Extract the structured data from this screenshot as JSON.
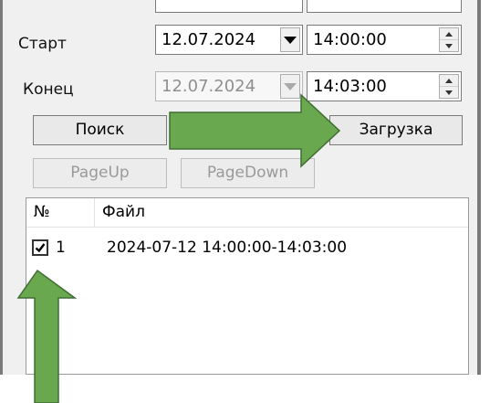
{
  "form": {
    "start_label": "Старт",
    "start_date": "12.07.2024",
    "start_time": "14:00:00",
    "end_label": "Конец",
    "end_date": "12.07.2024",
    "end_time": "14:03:00"
  },
  "buttons": {
    "search": "Поиск",
    "download": "Загрузка",
    "page_up": "PageUp",
    "page_down": "PageDown"
  },
  "list": {
    "columns": [
      "№",
      "Файл"
    ],
    "rows": [
      {
        "num": "1",
        "file": "2024-07-12 14:00:00-14:03:00",
        "checked": true
      }
    ]
  },
  "colors": {
    "arrow": "#6aa84f",
    "arrow_border": "#3f6d33"
  },
  "icons": {
    "checkbox": "checkbox-checked-icon",
    "dropdown": "chevron-down-icon",
    "spin": "spinner-updown-icon",
    "arrow_right": "arrow-right-icon",
    "arrow_up": "arrow-up-icon"
  }
}
